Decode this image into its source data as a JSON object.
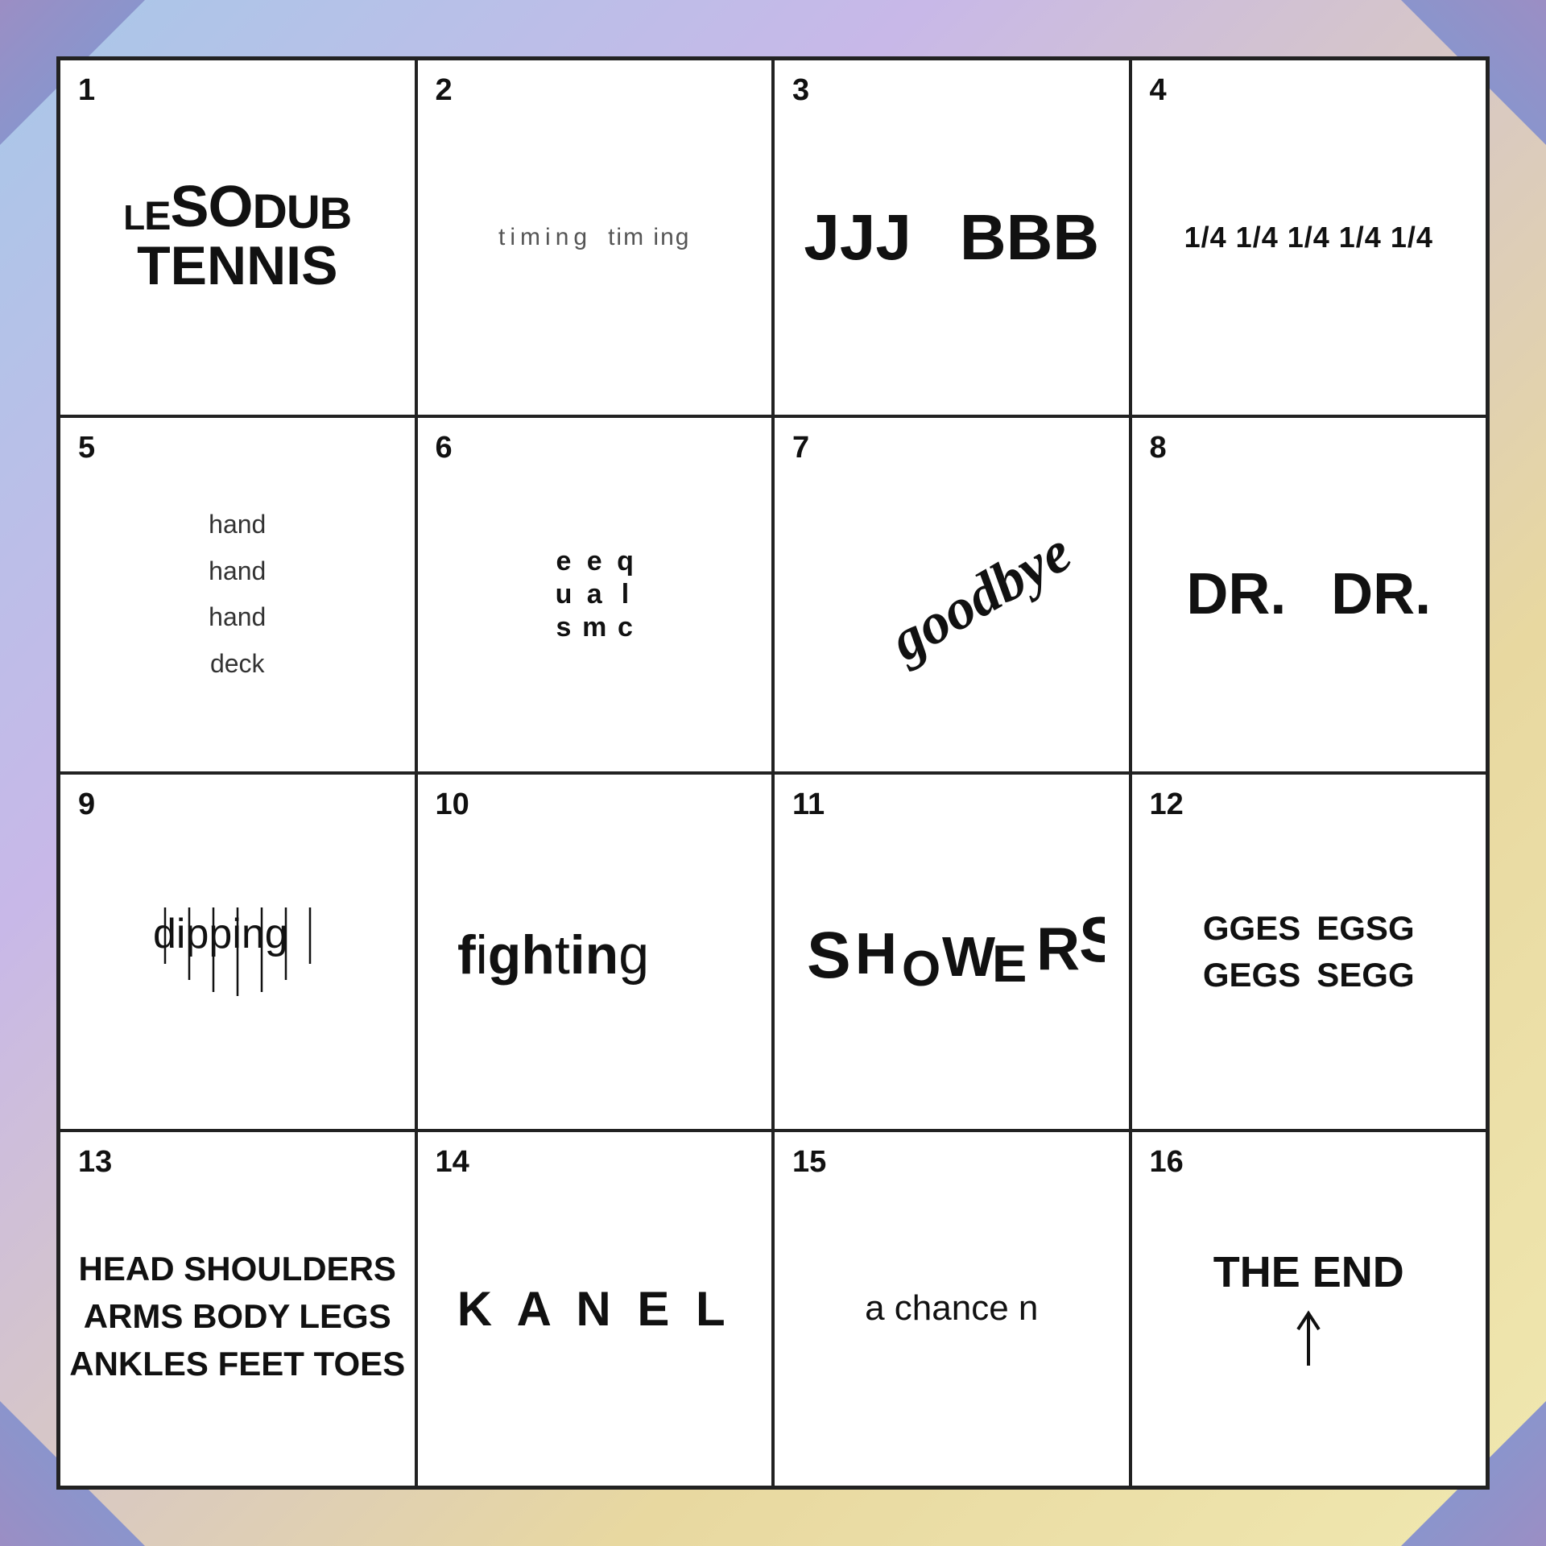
{
  "bg": "linear-gradient(135deg, #a8c8e8 0%, #c8b8e8 30%, #e8d8a0 70%, #f0e8b0 100%)",
  "cells": [
    {
      "number": "1",
      "content": "LESODUB TENNIS"
    },
    {
      "number": "2",
      "content": "timing   tim ing"
    },
    {
      "number": "3",
      "content": "JJJ   BBB"
    },
    {
      "number": "4",
      "content": "1/4 1/4 1/4 1/4 1/4"
    },
    {
      "number": "5",
      "lines": [
        "hand",
        "hand",
        "hand",
        "deck"
      ]
    },
    {
      "number": "6",
      "content": "e e q u a l s m c"
    },
    {
      "number": "7",
      "content": "goodbye"
    },
    {
      "number": "8",
      "content": "DR.   DR."
    },
    {
      "number": "9",
      "content": "dipping"
    },
    {
      "number": "10",
      "content": "fighting"
    },
    {
      "number": "11",
      "content": "SHOWERS"
    },
    {
      "number": "12",
      "content": "GGES EGSG GEGS SEGG"
    },
    {
      "number": "13",
      "content": "HEAD SHOULDERS ARMS BODY LEGS ANKLES FEET TOES"
    },
    {
      "number": "14",
      "content": "K A N E L"
    },
    {
      "number": "15",
      "content": "a chance n"
    },
    {
      "number": "16",
      "content": "THE END"
    }
  ]
}
